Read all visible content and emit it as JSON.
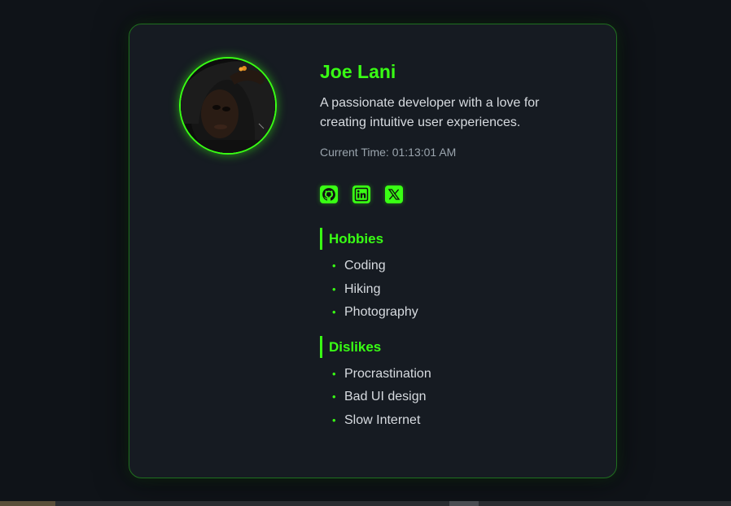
{
  "profile": {
    "name": "Joe Lani",
    "bio": "A passionate developer with a love for creating intuitive user experiences.",
    "time_label": "Current Time:",
    "time_value": "01:13:01 AM"
  },
  "socials": [
    {
      "icon": "github-icon"
    },
    {
      "icon": "linkedin-icon"
    },
    {
      "icon": "x-icon"
    }
  ],
  "hobbies": {
    "title": "Hobbies",
    "items": [
      "Coding",
      "Hiking",
      "Photography"
    ]
  },
  "dislikes": {
    "title": "Dislikes",
    "items": [
      "Procrastination",
      "Bad UI design",
      "Slow Internet"
    ]
  },
  "colors": {
    "accent": "#39ff14",
    "card_bg": "#161b22",
    "page_bg": "#0f1318"
  }
}
